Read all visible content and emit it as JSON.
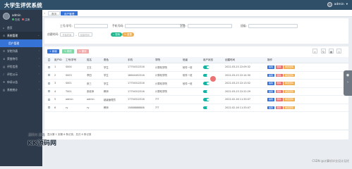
{
  "app": {
    "title": "大学生评优系统",
    "top_user": "admin"
  },
  "sidebar": {
    "user": {
      "name": "admin",
      "online": "在线",
      "logout": "注销"
    },
    "items": [
      {
        "label": "首页",
        "type": "item",
        "icon": "home-icon"
      },
      {
        "label": "系统管理",
        "type": "section",
        "icon": "gear-icon"
      },
      {
        "label": "用户管理",
        "type": "sub",
        "icon": ""
      },
      {
        "label": "学院列表",
        "type": "item",
        "icon": "list-icon"
      },
      {
        "label": "荣誉称号",
        "type": "item",
        "icon": "trophy-icon"
      },
      {
        "label": "评优信息",
        "type": "item",
        "icon": "file-icon"
      },
      {
        "label": "评优公示",
        "type": "item",
        "icon": "bell-icon"
      },
      {
        "label": "申诉公告",
        "type": "item",
        "icon": "flag-icon"
      },
      {
        "label": "系统统计",
        "type": "item",
        "icon": "chart-icon"
      }
    ]
  },
  "tabs": [
    {
      "label": "首页"
    },
    {
      "label": "用户管理"
    }
  ],
  "search": {
    "fields": [
      {
        "label": "工号/学号:",
        "placeholder": ""
      },
      {
        "label": "手机号码:",
        "placeholder": ""
      },
      {
        "label": "学院:",
        "placeholder": ""
      },
      {
        "label": "班级:",
        "placeholder": ""
      }
    ],
    "date_label": "创建时间:",
    "date_from": "开始时间",
    "date_to": "结束时间",
    "search_btn": "搜索",
    "reset_btn": "重置"
  },
  "toolbar": {
    "add": "新增",
    "edit": "修改",
    "delete": "删除",
    "icons": [
      "search-icon",
      "refresh-icon",
      "columns-icon",
      "export-icon"
    ]
  },
  "table": {
    "headers": [
      "用户ID",
      "工号/学号",
      "姓名",
      "角色",
      "手机",
      "学院",
      "班级",
      "用户状态",
      "创建时间",
      "操作"
    ],
    "rows": [
      [
        "1",
        "S004",
        "王五",
        "学生",
        "17754312316",
        "计算机学院",
        "软件一班",
        "",
        "2022-03-23 22:09:32"
      ],
      [
        "2",
        "S003",
        "李四",
        "学生",
        "18644452316",
        "计算机学院",
        "软件一班",
        "",
        "2022-03-23 22:14:30"
      ],
      [
        "3",
        "S001",
        "张三",
        "学生",
        "17754312316",
        "计算机学院",
        "软件一班",
        "",
        "2022-03-23 22:13:52"
      ],
      [
        "4",
        "T001",
        "张老师",
        "教师",
        "17754312316",
        "计算机学院",
        "",
        "",
        "2022-03-23 22:22:29"
      ],
      [
        "5",
        "admin",
        "admin",
        "超级管理员",
        "17754312316",
        "???",
        "",
        "",
        "2022-02-16 11:33:07"
      ],
      [
        "6",
        "ry",
        "ry",
        "教师",
        "15888888888",
        "???",
        "",
        "",
        "2022-02-16 11:33:07"
      ]
    ],
    "actions": [
      "编辑",
      "删除",
      "重置密码"
    ]
  },
  "footer": "显示第 1 到第 6 条记录，总共 6 条记录",
  "watermarks": {
    "left_top": "源码IS 源码",
    "left_bottom": "KK源码网",
    "right": "CSDN @计算机毕业设计无忧"
  },
  "colors": {
    "header": "#2f4f69",
    "sidebar": "#2d3a4b",
    "primary": "#3573d6",
    "success": "#1fb58f",
    "danger": "#e86b6b",
    "toggle": "#14b3a3",
    "act_edit": "#3573d6",
    "act_key": "#f0ad4e"
  }
}
